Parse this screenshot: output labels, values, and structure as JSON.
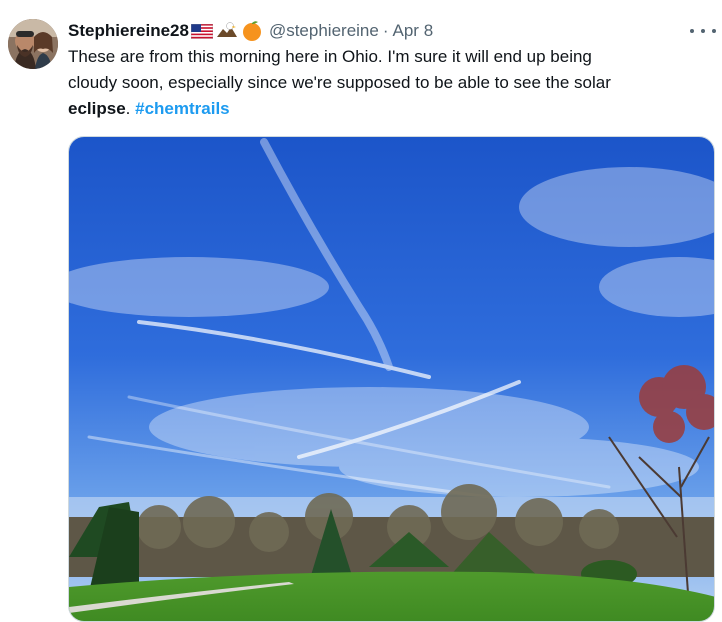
{
  "tweet": {
    "display_name": "Stephiereine28",
    "name_emojis": [
      "us-flag-icon",
      "eagle-icon",
      "orange-icon"
    ],
    "handle": "@stephiereine",
    "separator": "·",
    "date": "Apr 8",
    "text_line1": "These are from this morning here in Ohio. I'm sure it will end up being",
    "text_line2": "cloudy soon, especially since we're supposed to be able to see the solar",
    "text_line3_bold": "eclipse",
    "text_line3_period": ".",
    "hashtag": "#chemtrails",
    "more_icon": "more-horizontal-icon",
    "media": "photo-blue-sky-with-contrails-trees-lawn"
  },
  "colors": {
    "text": "#0f1419",
    "secondary": "#536471",
    "link": "#1d9bf0",
    "border": "#cfd9de"
  }
}
